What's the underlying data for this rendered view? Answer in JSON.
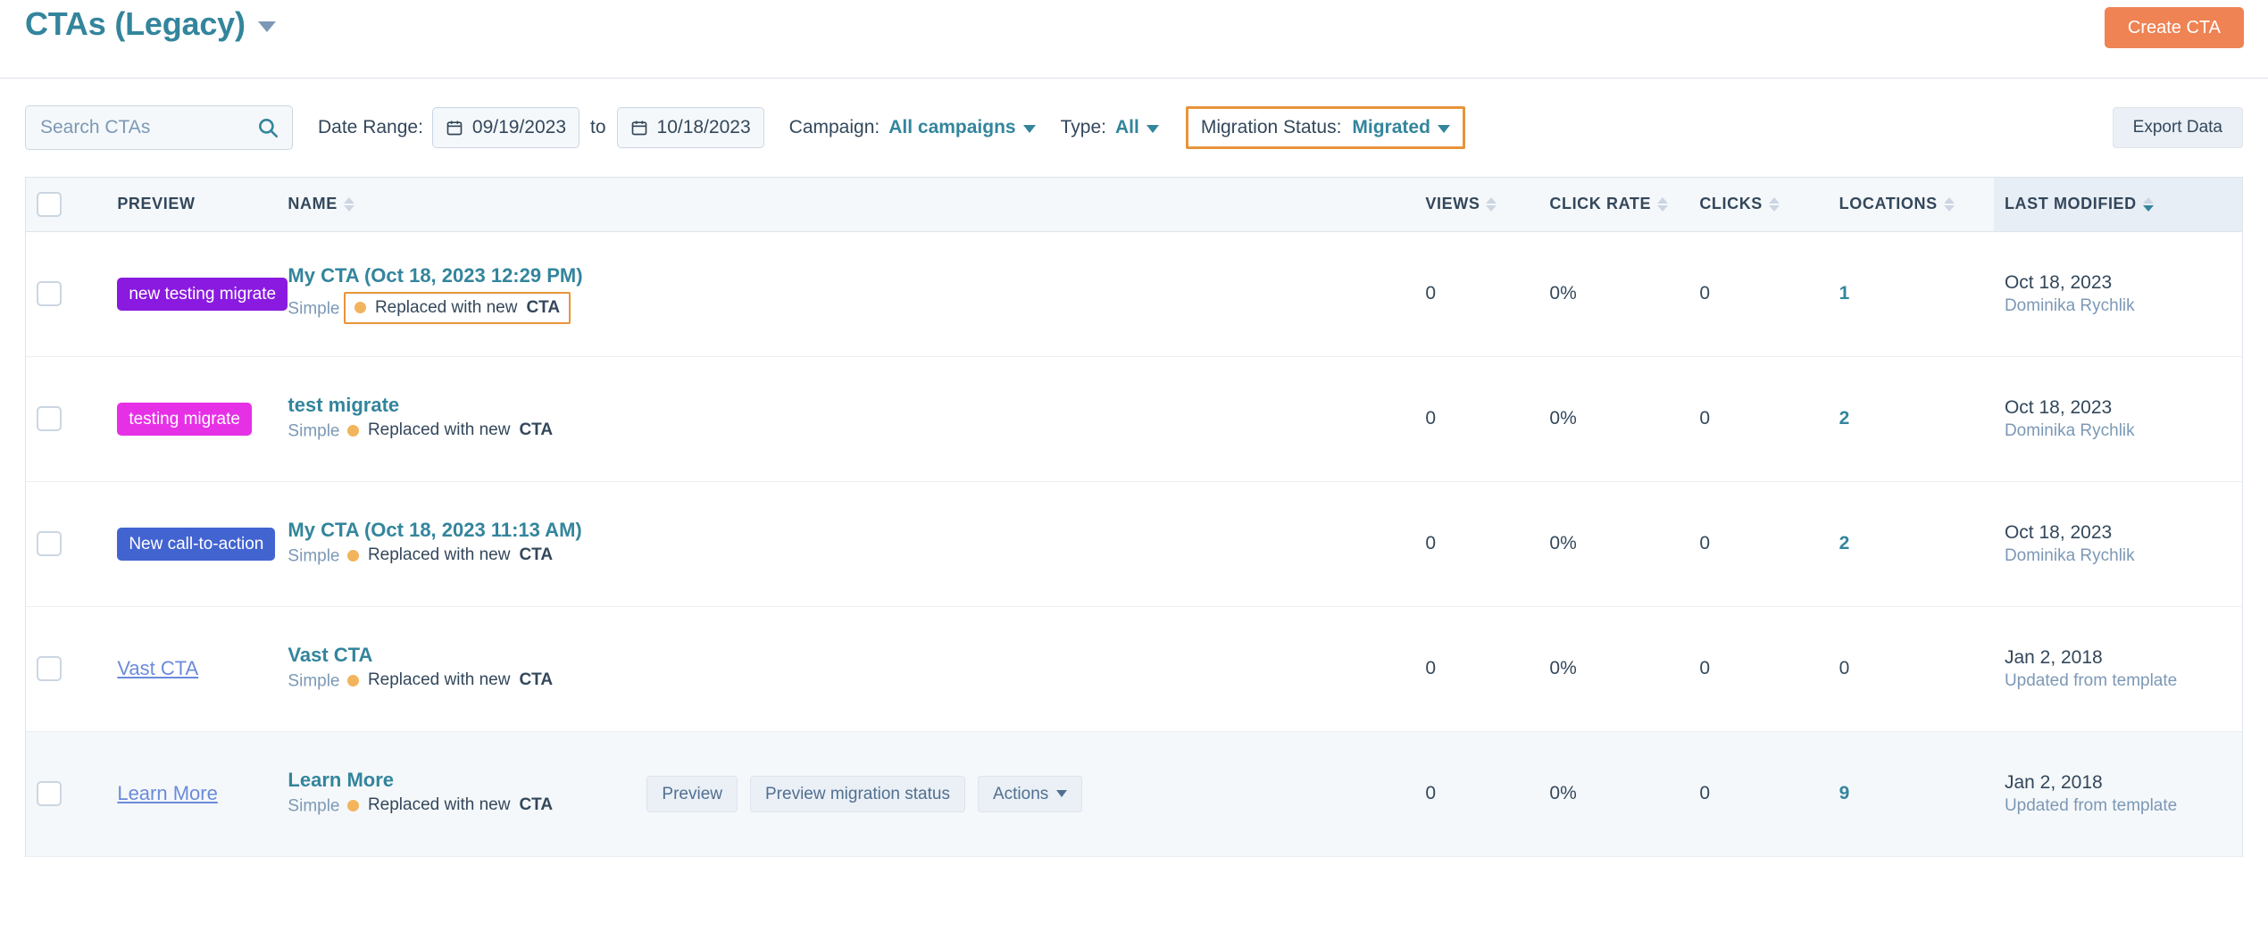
{
  "header": {
    "title": "CTAs (Legacy)",
    "title_caret_icon": "chevron-down-icon",
    "create_button": "Create CTA",
    "create_button_color": "#ef8354"
  },
  "filters": {
    "search_placeholder": "Search CTAs",
    "search_value": "",
    "search_icon": "search-icon",
    "date_range_label": "Date Range:",
    "date_from": "09/19/2023",
    "date_to": "10/18/2023",
    "to_word": "to",
    "calendar_icon": "calendar-icon",
    "campaign_label": "Campaign:",
    "campaign_value": "All campaigns",
    "type_label": "Type:",
    "type_value": "All",
    "migration_label": "Migration Status:",
    "migration_value": "Migrated",
    "migration_highlight_color": "#e8943a",
    "export_button": "Export Data"
  },
  "table": {
    "columns": [
      {
        "key": "preview",
        "label": "PREVIEW",
        "sortable": false
      },
      {
        "key": "name",
        "label": "NAME",
        "sortable": true
      },
      {
        "key": "views",
        "label": "VIEWS",
        "sortable": true
      },
      {
        "key": "click_rate",
        "label": "CLICK RATE",
        "sortable": true
      },
      {
        "key": "clicks",
        "label": "CLICKS",
        "sortable": true
      },
      {
        "key": "locations",
        "label": "LOCATIONS",
        "sortable": true
      },
      {
        "key": "last_modified",
        "label": "LAST MODIFIED",
        "sortable": true,
        "sorted": "desc"
      }
    ],
    "rows": [
      {
        "checked": false,
        "preview_kind": "badge",
        "preview_text": "new testing migrate",
        "preview_color": "#8a1ae0",
        "name": "My CTA (Oct 18, 2023 12:29 PM)",
        "type": "Simple",
        "status": "Replaced with new",
        "status_bold": "CTA",
        "status_highlighted": true,
        "views": "0",
        "click_rate": "0%",
        "clicks": "0",
        "locations": "1",
        "locations_is_link": true,
        "last_modified_date": "Oct 18, 2023",
        "last_modified_by": "Dominika Rychlik",
        "hovered": false,
        "show_actions": false
      },
      {
        "checked": false,
        "preview_kind": "badge",
        "preview_text": "testing migrate",
        "preview_color": "#e630e6",
        "name": "test migrate",
        "type": "Simple",
        "status": "Replaced with new",
        "status_bold": "CTA",
        "status_highlighted": false,
        "views": "0",
        "click_rate": "0%",
        "clicks": "0",
        "locations": "2",
        "locations_is_link": true,
        "last_modified_date": "Oct 18, 2023",
        "last_modified_by": "Dominika Rychlik",
        "hovered": false,
        "show_actions": false
      },
      {
        "checked": false,
        "preview_kind": "badge",
        "preview_text": "New call-to-action",
        "preview_color": "#4264d0",
        "name": "My CTA (Oct 18, 2023 11:13 AM)",
        "type": "Simple",
        "status": "Replaced with new",
        "status_bold": "CTA",
        "status_highlighted": false,
        "views": "0",
        "click_rate": "0%",
        "clicks": "0",
        "locations": "2",
        "locations_is_link": true,
        "last_modified_date": "Oct 18, 2023",
        "last_modified_by": "Dominika Rychlik",
        "hovered": false,
        "show_actions": false
      },
      {
        "checked": false,
        "preview_kind": "link",
        "preview_text": "Vast CTA",
        "preview_color": "#6a8bdb",
        "name": "Vast CTA",
        "type": "Simple",
        "status": "Replaced with new",
        "status_bold": "CTA",
        "status_highlighted": false,
        "views": "0",
        "click_rate": "0%",
        "clicks": "0",
        "locations": "0",
        "locations_is_link": false,
        "last_modified_date": "Jan 2, 2018",
        "last_modified_by": "Updated from template",
        "hovered": false,
        "show_actions": false
      },
      {
        "checked": false,
        "preview_kind": "link",
        "preview_text": "Learn More",
        "preview_color": "#6a8bdb",
        "name": "Learn More",
        "type": "Simple",
        "status": "Replaced with new",
        "status_bold": "CTA",
        "status_highlighted": false,
        "views": "0",
        "click_rate": "0%",
        "clicks": "0",
        "locations": "9",
        "locations_is_link": true,
        "last_modified_date": "Jan 2, 2018",
        "last_modified_by": "Updated from template",
        "hovered": true,
        "show_actions": true,
        "actions": {
          "preview": "Preview",
          "migration_status": "Preview migration status",
          "actions_menu": "Actions"
        }
      }
    ]
  }
}
